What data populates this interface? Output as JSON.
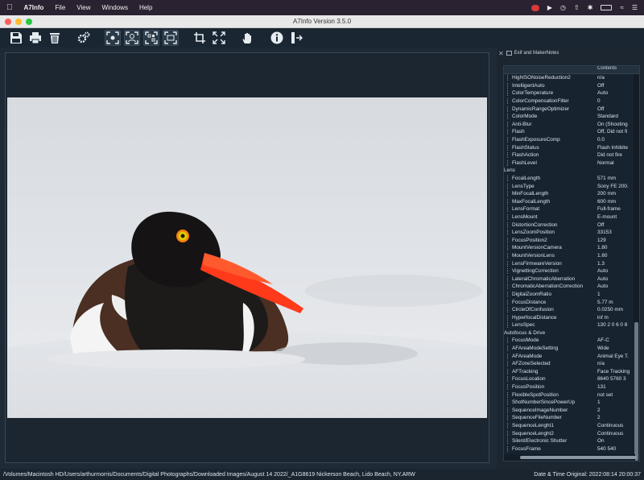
{
  "menubar": {
    "app_name": "A7Info",
    "items": [
      "File",
      "View",
      "Windows",
      "Help"
    ]
  },
  "window": {
    "title": "A7Info Version 3.5.0"
  },
  "panel": {
    "title": "Exif and MakerNotes",
    "col_key": "",
    "col_value": "Contents",
    "rows": [
      {
        "k": "HighISONoiseReduction2",
        "v": "n/a"
      },
      {
        "k": "IntelligentAuto",
        "v": "Off"
      },
      {
        "k": "ColorTemperature",
        "v": "Auto"
      },
      {
        "k": "ColorCompensationFilter",
        "v": "0"
      },
      {
        "k": "DynamicRangeOptimizer",
        "v": "Off"
      },
      {
        "k": "ColorMode",
        "v": "Standard"
      },
      {
        "k": "Anti-Blur",
        "v": "On (Shooting"
      },
      {
        "k": "Flash",
        "v": "Off, Did not fi"
      },
      {
        "k": "FlashExposureComp",
        "v": "0.0"
      },
      {
        "k": "FlashStatus",
        "v": "Flash Inhibite"
      },
      {
        "k": "FlashAction",
        "v": "Did not fire"
      },
      {
        "k": "FlashLevel",
        "v": "Normal"
      },
      {
        "group": true,
        "k": "Lens"
      },
      {
        "k": "FocalLength",
        "v": "571 mm"
      },
      {
        "k": "LensType",
        "v": "Sony FE 200."
      },
      {
        "k": "MinFocalLength",
        "v": "200 mm"
      },
      {
        "k": "MaxFocalLength",
        "v": "600 mm"
      },
      {
        "k": "LensFormat",
        "v": "Full-frame"
      },
      {
        "k": "LensMount",
        "v": "E-mount"
      },
      {
        "k": "DistortionCorrection",
        "v": "Off"
      },
      {
        "k": "LensZoomPosition",
        "v": "33153"
      },
      {
        "k": "FocusPosition2",
        "v": "129"
      },
      {
        "k": "MountVersionCamera",
        "v": "1.80"
      },
      {
        "k": "MountVersionLens",
        "v": "1.60"
      },
      {
        "k": "LensFirmwareVersion",
        "v": "1.3"
      },
      {
        "k": "VignettingCorrection",
        "v": "Auto"
      },
      {
        "k": "LateralChromaticAberration",
        "v": "Auto"
      },
      {
        "k": "ChromaticAberrationCorrection",
        "v": "Auto"
      },
      {
        "k": "DigitalZoomRatio",
        "v": "1"
      },
      {
        "k": "FocusDistance",
        "v": "5.77 m"
      },
      {
        "k": "CircleOfConfusion",
        "v": "0.0250 mm"
      },
      {
        "k": "HyperfocalDistance",
        "v": "inf m"
      },
      {
        "k": "LensSpec",
        "v": "130 2 0 6 0 8"
      },
      {
        "group": true,
        "k": "Autofocus & Drive"
      },
      {
        "k": "FocusMode",
        "v": "AF-C"
      },
      {
        "k": "AFAreaModeSetting",
        "v": "Wide"
      },
      {
        "k": "AFAreaMode",
        "v": "Animal Eye T."
      },
      {
        "k": "AFZoneSelected",
        "v": "n/a"
      },
      {
        "k": "AFTracking",
        "v": "Face Tracking"
      },
      {
        "k": "FocusLocation",
        "v": "8640 5760 3"
      },
      {
        "k": "FocusPosition",
        "v": "131"
      },
      {
        "k": "FlexibleSpotPosition",
        "v": "not set"
      },
      {
        "k": "ShotNumberSincePowerUp",
        "v": "1"
      },
      {
        "k": "SequenceImageNumber",
        "v": "2"
      },
      {
        "k": "SequenceFileNumber",
        "v": "2"
      },
      {
        "k": "SequenceLenght1",
        "v": "Continuous"
      },
      {
        "k": "SequenceLenght2",
        "v": "Continuous"
      },
      {
        "k": "Silent/Electronic Shutter",
        "v": "On"
      },
      {
        "k": "FocusFrame",
        "v": "540 540"
      }
    ]
  },
  "status": {
    "path": "/Volumes/Macintosh HD/Users/arthurmorris/Documents/Digital Photographs/Downloaded Images/August 14 2022/_A1G8619 Nickerson Beach, Lido Beach, NY.ARW",
    "date": "Date & Time Original: 2022:08:14 20:00:37"
  },
  "colors": {
    "accent": "#1a2733",
    "bill": "#ff3a1a"
  }
}
